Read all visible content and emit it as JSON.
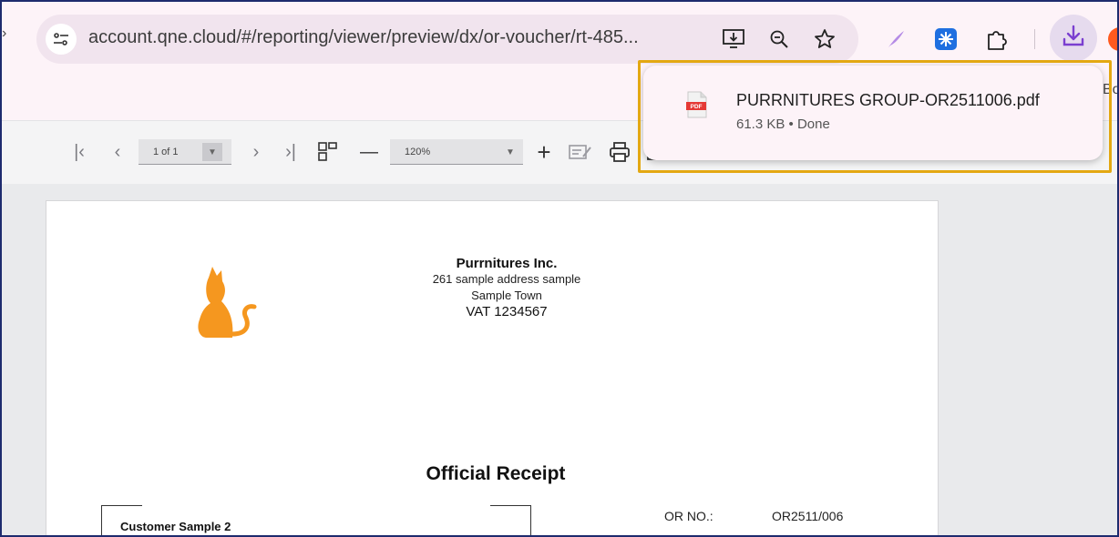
{
  "browser": {
    "url": "account.qne.cloud/#/reporting/viewer/preview/dx/or-voucher/rt-485...",
    "bookmark_peek": "Bo"
  },
  "icons": {
    "site_info": "tune-icon",
    "install": "install-app-icon",
    "zoom": "zoom-icon",
    "bookmark": "star-icon",
    "ext1": "feather-extension-icon",
    "ext2": "snowflake-extension-icon",
    "extensions": "puzzle-icon",
    "downloads": "download-icon"
  },
  "viewer": {
    "page_select": "1 of 1",
    "zoom_select": "120%"
  },
  "document": {
    "company_name": "Purrnitures Inc.",
    "address_line1": "261 sample address sample",
    "address_line2": "Sample Town",
    "vat": "VAT 1234567",
    "title": "Official Receipt",
    "customer": "Customer Sample 2",
    "or_label": "OR NO.:",
    "or_value": "OR2511/006"
  },
  "download": {
    "file_name": "PURRNITURES GROUP-OR2511006.pdf",
    "meta": "61.3 KB • Done",
    "file_type": "PDF"
  },
  "colors": {
    "highlight": "#e3a812",
    "logo": "#f5971f",
    "pdf_red": "#e53935",
    "download_accent": "#7b3fd0"
  }
}
